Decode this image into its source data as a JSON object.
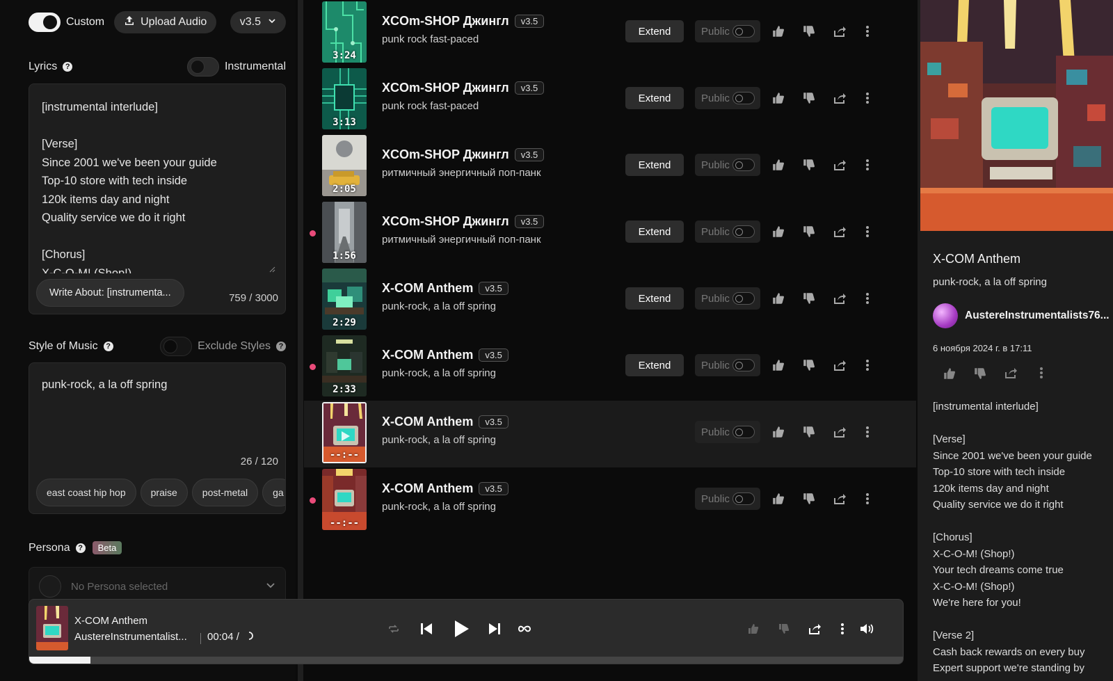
{
  "header": {
    "custom_label": "Custom",
    "upload_label": "Upload Audio",
    "version": "v3.5"
  },
  "lyrics": {
    "label": "Lyrics",
    "instrumental_label": "Instrumental",
    "text": "[instrumental interlude]\n\n[Verse]\nSince 2001 we've been your guide\nTop-10 store with tech inside\n120k items day and night\nQuality service we do it right\n\n[Chorus]\nX-C-O-M! (Shop!)",
    "write_about": "Write About: [instrumenta...",
    "counter": "759 / 3000"
  },
  "style": {
    "label": "Style of Music",
    "exclude_label": "Exclude Styles",
    "text": "punk-rock, a la off spring",
    "counter": "26 / 120",
    "chips": [
      "east coast hip hop",
      "praise",
      "post-metal",
      "ga"
    ]
  },
  "persona": {
    "label": "Persona",
    "beta": "Beta",
    "placeholder": "No Persona selected"
  },
  "songs": [
    {
      "title": "XCOm-SHOP Джингл",
      "version": "v3.5",
      "style": "punk rock fast-paced",
      "duration": "3:24",
      "extend": "Extend",
      "public": "Public",
      "unplayed": false,
      "active": false,
      "art": "circuit"
    },
    {
      "title": "XCOm-SHOP Джингл",
      "version": "v3.5",
      "style": "punk rock fast-paced",
      "duration": "3:13",
      "extend": "Extend",
      "public": "Public",
      "unplayed": false,
      "active": false,
      "art": "chip"
    },
    {
      "title": "XCOm-SHOP Джингл",
      "version": "v3.5",
      "style": "ритмичный энергичный поп-панк",
      "duration": "2:05",
      "extend": "Extend",
      "public": "Public",
      "unplayed": false,
      "active": false,
      "art": "car"
    },
    {
      "title": "XCOm-SHOP Джингл",
      "version": "v3.5",
      "style": "ритмичный энергичный поп-панк",
      "duration": "1:56",
      "extend": "Extend",
      "public": "Public",
      "unplayed": true,
      "active": false,
      "art": "street"
    },
    {
      "title": "X-COM Anthem",
      "version": "v3.5",
      "style": "punk-rock, a la off spring",
      "duration": "2:29",
      "extend": "Extend",
      "public": "Public",
      "unplayed": false,
      "active": false,
      "art": "room-green"
    },
    {
      "title": "X-COM Anthem",
      "version": "v3.5",
      "style": "punk-rock, a la off spring",
      "duration": "2:33",
      "extend": "Extend",
      "public": "Public",
      "unplayed": true,
      "active": false,
      "art": "room-dark"
    },
    {
      "title": "X-COM Anthem",
      "version": "v3.5",
      "style": "punk-rock, a la off spring",
      "duration": "--:--",
      "extend": "",
      "public": "Public",
      "unplayed": false,
      "active": true,
      "art": "room-red"
    },
    {
      "title": "X-COM Anthem",
      "version": "v3.5",
      "style": "punk-rock, a la off spring",
      "duration": "--:--",
      "extend": "",
      "public": "Public",
      "unplayed": true,
      "active": false,
      "art": "room-red2"
    }
  ],
  "detail": {
    "title": "X-COM Anthem",
    "style": "punk-rock,  a la off spring",
    "user": "AustereInstrumentalists76...",
    "date": "6 ноября 2024 г. в 17:11",
    "lyrics": "[instrumental interlude]\n\n[Verse]\nSince 2001 we've been your guide\nTop-10 store with tech inside\n120k items day and night\nQuality service we do it right\n\n[Chorus]\nX-C-O-M! (Shop!)\nYour tech dreams come true\nX-C-O-M! (Shop!)\nWe're here for you!\n\n[Verse 2]\nCash back rewards on every buy\nExpert support we're standing by"
  },
  "player": {
    "title": "X-COM Anthem",
    "artist": "AustereInstrumentalist...",
    "time": "00:04 /",
    "progress": 0.07
  },
  "colors": {
    "accent_dot": "#e94b7a",
    "background": "#0b0b0b",
    "panel": "#1e1e1e"
  }
}
